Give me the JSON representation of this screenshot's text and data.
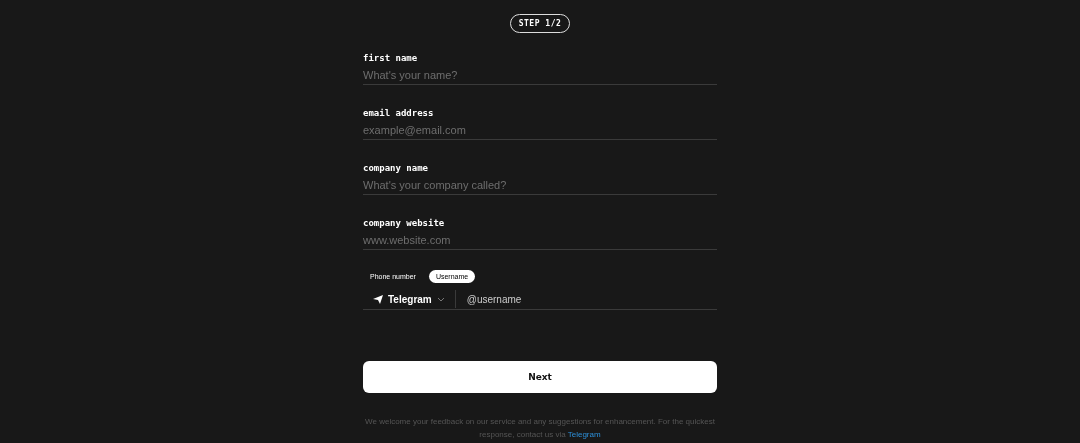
{
  "step_badge": "STEP 1/2",
  "fields": [
    {
      "label": "first name",
      "placeholder": "What's your name?"
    },
    {
      "label": "email address",
      "placeholder": "example@email.com"
    },
    {
      "label": "company name",
      "placeholder": "What's your company called?"
    },
    {
      "label": "company website",
      "placeholder": "www.website.com"
    }
  ],
  "contact_toggle": [
    {
      "label": "Phone number",
      "selected": false
    },
    {
      "label": "Username",
      "selected": true
    }
  ],
  "messenger": {
    "label": "Telegram"
  },
  "username": {
    "placeholder": "@username"
  },
  "next_button": "Next",
  "footer": {
    "text": "We welcome your feedback on our service and any suggestions for enhancement. For the quickest response, contact us via",
    "link": "Telegram"
  }
}
